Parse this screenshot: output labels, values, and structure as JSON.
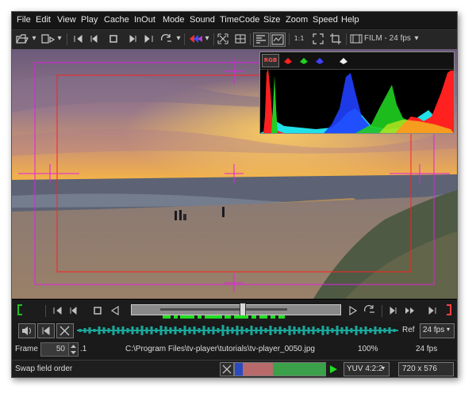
{
  "menu": [
    "File",
    "Edit",
    "View",
    "Play",
    "Cache",
    "InOut",
    "Mode",
    "Sound",
    "TimeCode",
    "Size",
    "Zoom",
    "Speed",
    "Help"
  ],
  "toolbar": {
    "one_to_one": "1:1",
    "fps_mode": "FILM - 24 fps",
    "chevron": "▾"
  },
  "histogram": {
    "channels": [
      "RGB",
      "R",
      "G",
      "B",
      "L"
    ],
    "colors": {
      "red": "#ff2020",
      "green": "#20d020",
      "blue": "#2040ff",
      "cyan": "#20e0e8",
      "yellow": "#f0f020",
      "white": "#ffffff"
    }
  },
  "audio": {
    "ref_label": "Ref",
    "ref_fps": "24 fps"
  },
  "frame": {
    "label": "Frame",
    "value": "50",
    "suffix": ".1",
    "file_path": "C:\\Program Files\\tv-player\\tutorials\\tv-player_0050.jpg",
    "zoom": "100%",
    "fps": "24 fps"
  },
  "status": {
    "message": "Swap field order",
    "colorspace": "YUV 4:2:2",
    "resolution": "720 x 576"
  },
  "theme": {
    "overlay_magenta": "#e020e0",
    "overlay_red": "#ff2020",
    "in_point": "#20c020",
    "out_point": "#ff4040",
    "waveform": "#1aa89a",
    "cache": "#22dd22"
  }
}
